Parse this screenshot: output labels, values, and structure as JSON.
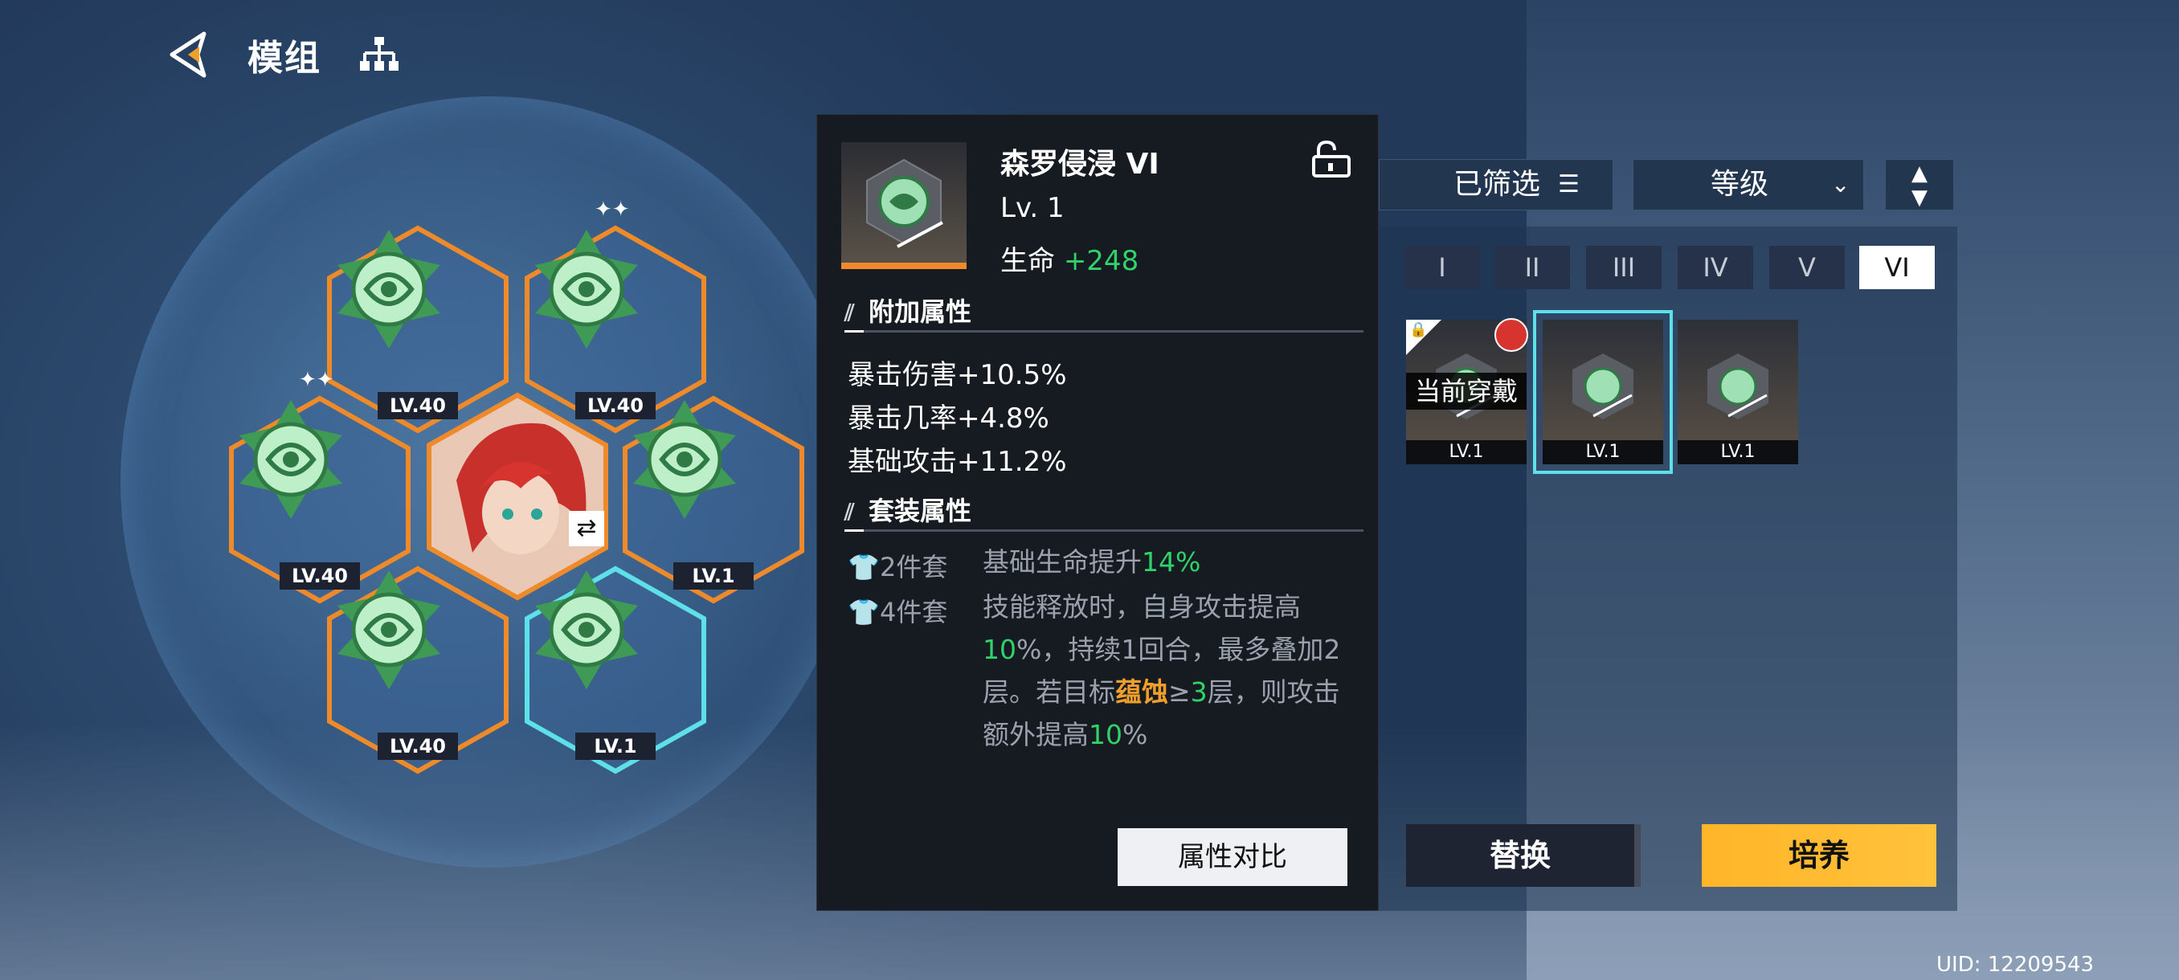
{
  "header": {
    "title": "模组"
  },
  "left_modules": [
    {
      "level": "LV.40",
      "sparkle": ""
    },
    {
      "level": "LV.40",
      "sparkle": "✦✦"
    },
    {
      "level": "LV.40",
      "sparkle": "✦✦"
    },
    {
      "level": "LV.1",
      "sparkle": ""
    },
    {
      "level": "LV.40",
      "sparkle": ""
    },
    {
      "level": "LV.1",
      "sparkle": "",
      "selected": true
    }
  ],
  "detail": {
    "name": "森罗侵浸 VI",
    "level": "Lv. 1",
    "main_stat_label": "生命",
    "main_stat_value": "+248",
    "extra_title": "附加属性",
    "extra_stats": [
      "暴击伤害+10.5%",
      "暴击几率+4.8%",
      "基础攻击+11.2%"
    ],
    "set_title": "套装属性",
    "set2_label": "2件套",
    "set2_text": "基础生命提升",
    "set2_value": "14%",
    "set4_label": "4件套",
    "set4_t1": "技能释放时，自身攻击提高",
    "set4_v1": "10",
    "set4_t2": "%，持续1回合，最多叠加2层。若目标",
    "set4_kw": "蕴蚀",
    "set4_t3": "≥",
    "set4_v2": "3",
    "set4_t4": "层，则攻击额外提高",
    "set4_v3": "10",
    "set4_t5": "%",
    "compare_btn": "属性对比"
  },
  "filter": {
    "filter_label": "已筛选",
    "sort_label": "等级"
  },
  "tabs": [
    "I",
    "II",
    "III",
    "IV",
    "V",
    "VI"
  ],
  "selected_tab": "VI",
  "cards": [
    {
      "level": "LV.1",
      "equipped_label": "当前穿戴"
    },
    {
      "level": "LV.1"
    },
    {
      "level": "LV.1"
    }
  ],
  "actions": {
    "swap": "替换",
    "train": "培养"
  },
  "uid": "UID: 12209543",
  "colors": {
    "accent_orange": "#ef8a2a",
    "green": "#2fd36a",
    "keyword": "#f0a02a",
    "selected_cyan": "#5ee0e8",
    "train_button": "#ffb528"
  }
}
